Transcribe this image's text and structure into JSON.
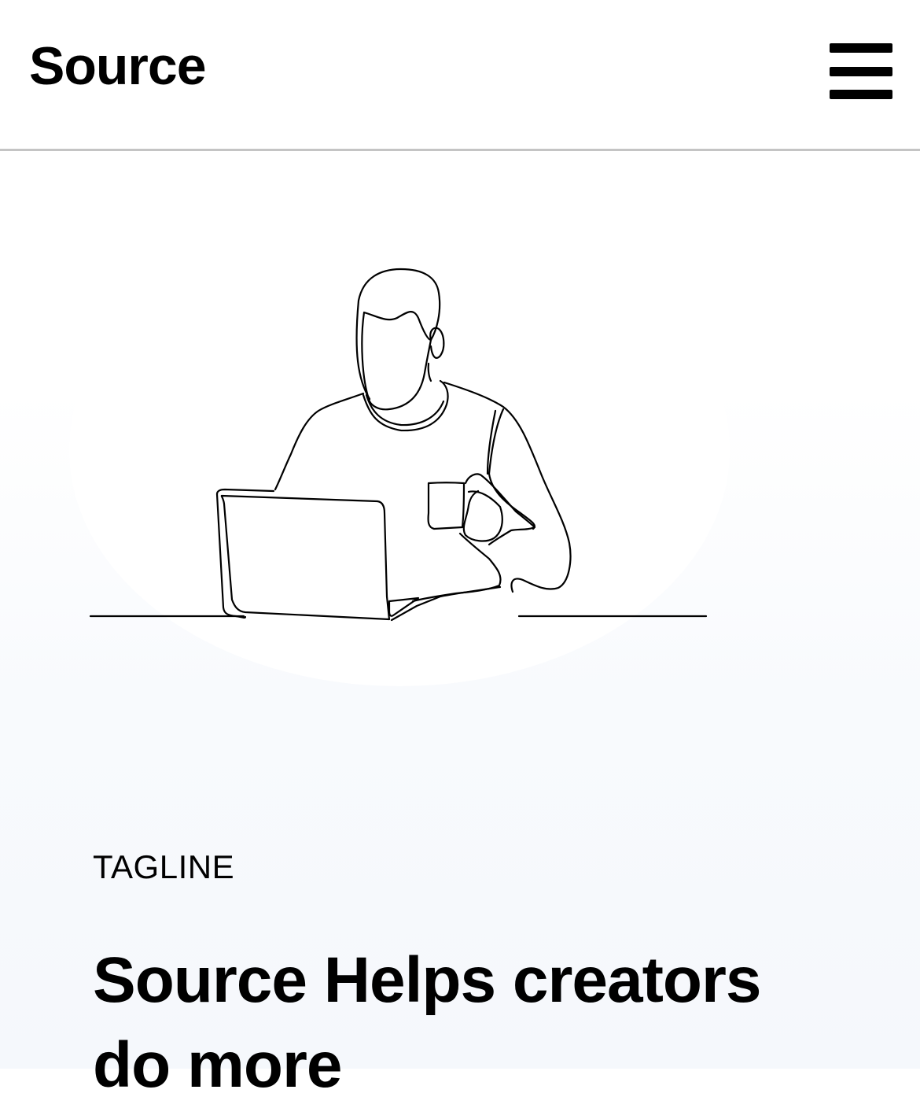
{
  "header": {
    "logo": "Source",
    "menu_icon": "hamburger-menu-icon"
  },
  "hero": {
    "illustration": "person-with-laptop-and-mug-line-art",
    "tagline": "TAGLINE",
    "headline": "Source Helps creators do more"
  }
}
